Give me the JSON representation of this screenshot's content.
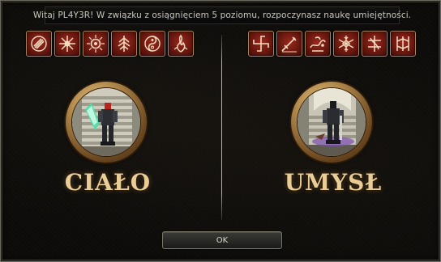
{
  "window": {
    "title": "Witaj PL4Y3R! W związku z osiągnięciem 5 poziomu, rozpoczynasz naukę umiejętności."
  },
  "paths": {
    "body": {
      "label": "CIAŁO",
      "skill_icons": [
        "slash-skill-icon",
        "burst-skill-icon",
        "aura-skill-icon",
        "tree-skill-icon",
        "spiral-skill-icon",
        "flame-skill-icon"
      ]
    },
    "mind": {
      "label": "UMYSŁ",
      "skill_icons": [
        "swirl-skill-icon",
        "sword-skill-icon",
        "dash-skill-icon",
        "snowflake-skill-icon",
        "pierce-skill-icon",
        "gate-skill-icon"
      ]
    }
  },
  "ok_button": {
    "label": "OK"
  },
  "colors": {
    "label_gold": "#e8cd96",
    "icon_red": "#9a2a1e",
    "icon_frame": "#a88858",
    "window_bg": "#0c0b09"
  }
}
